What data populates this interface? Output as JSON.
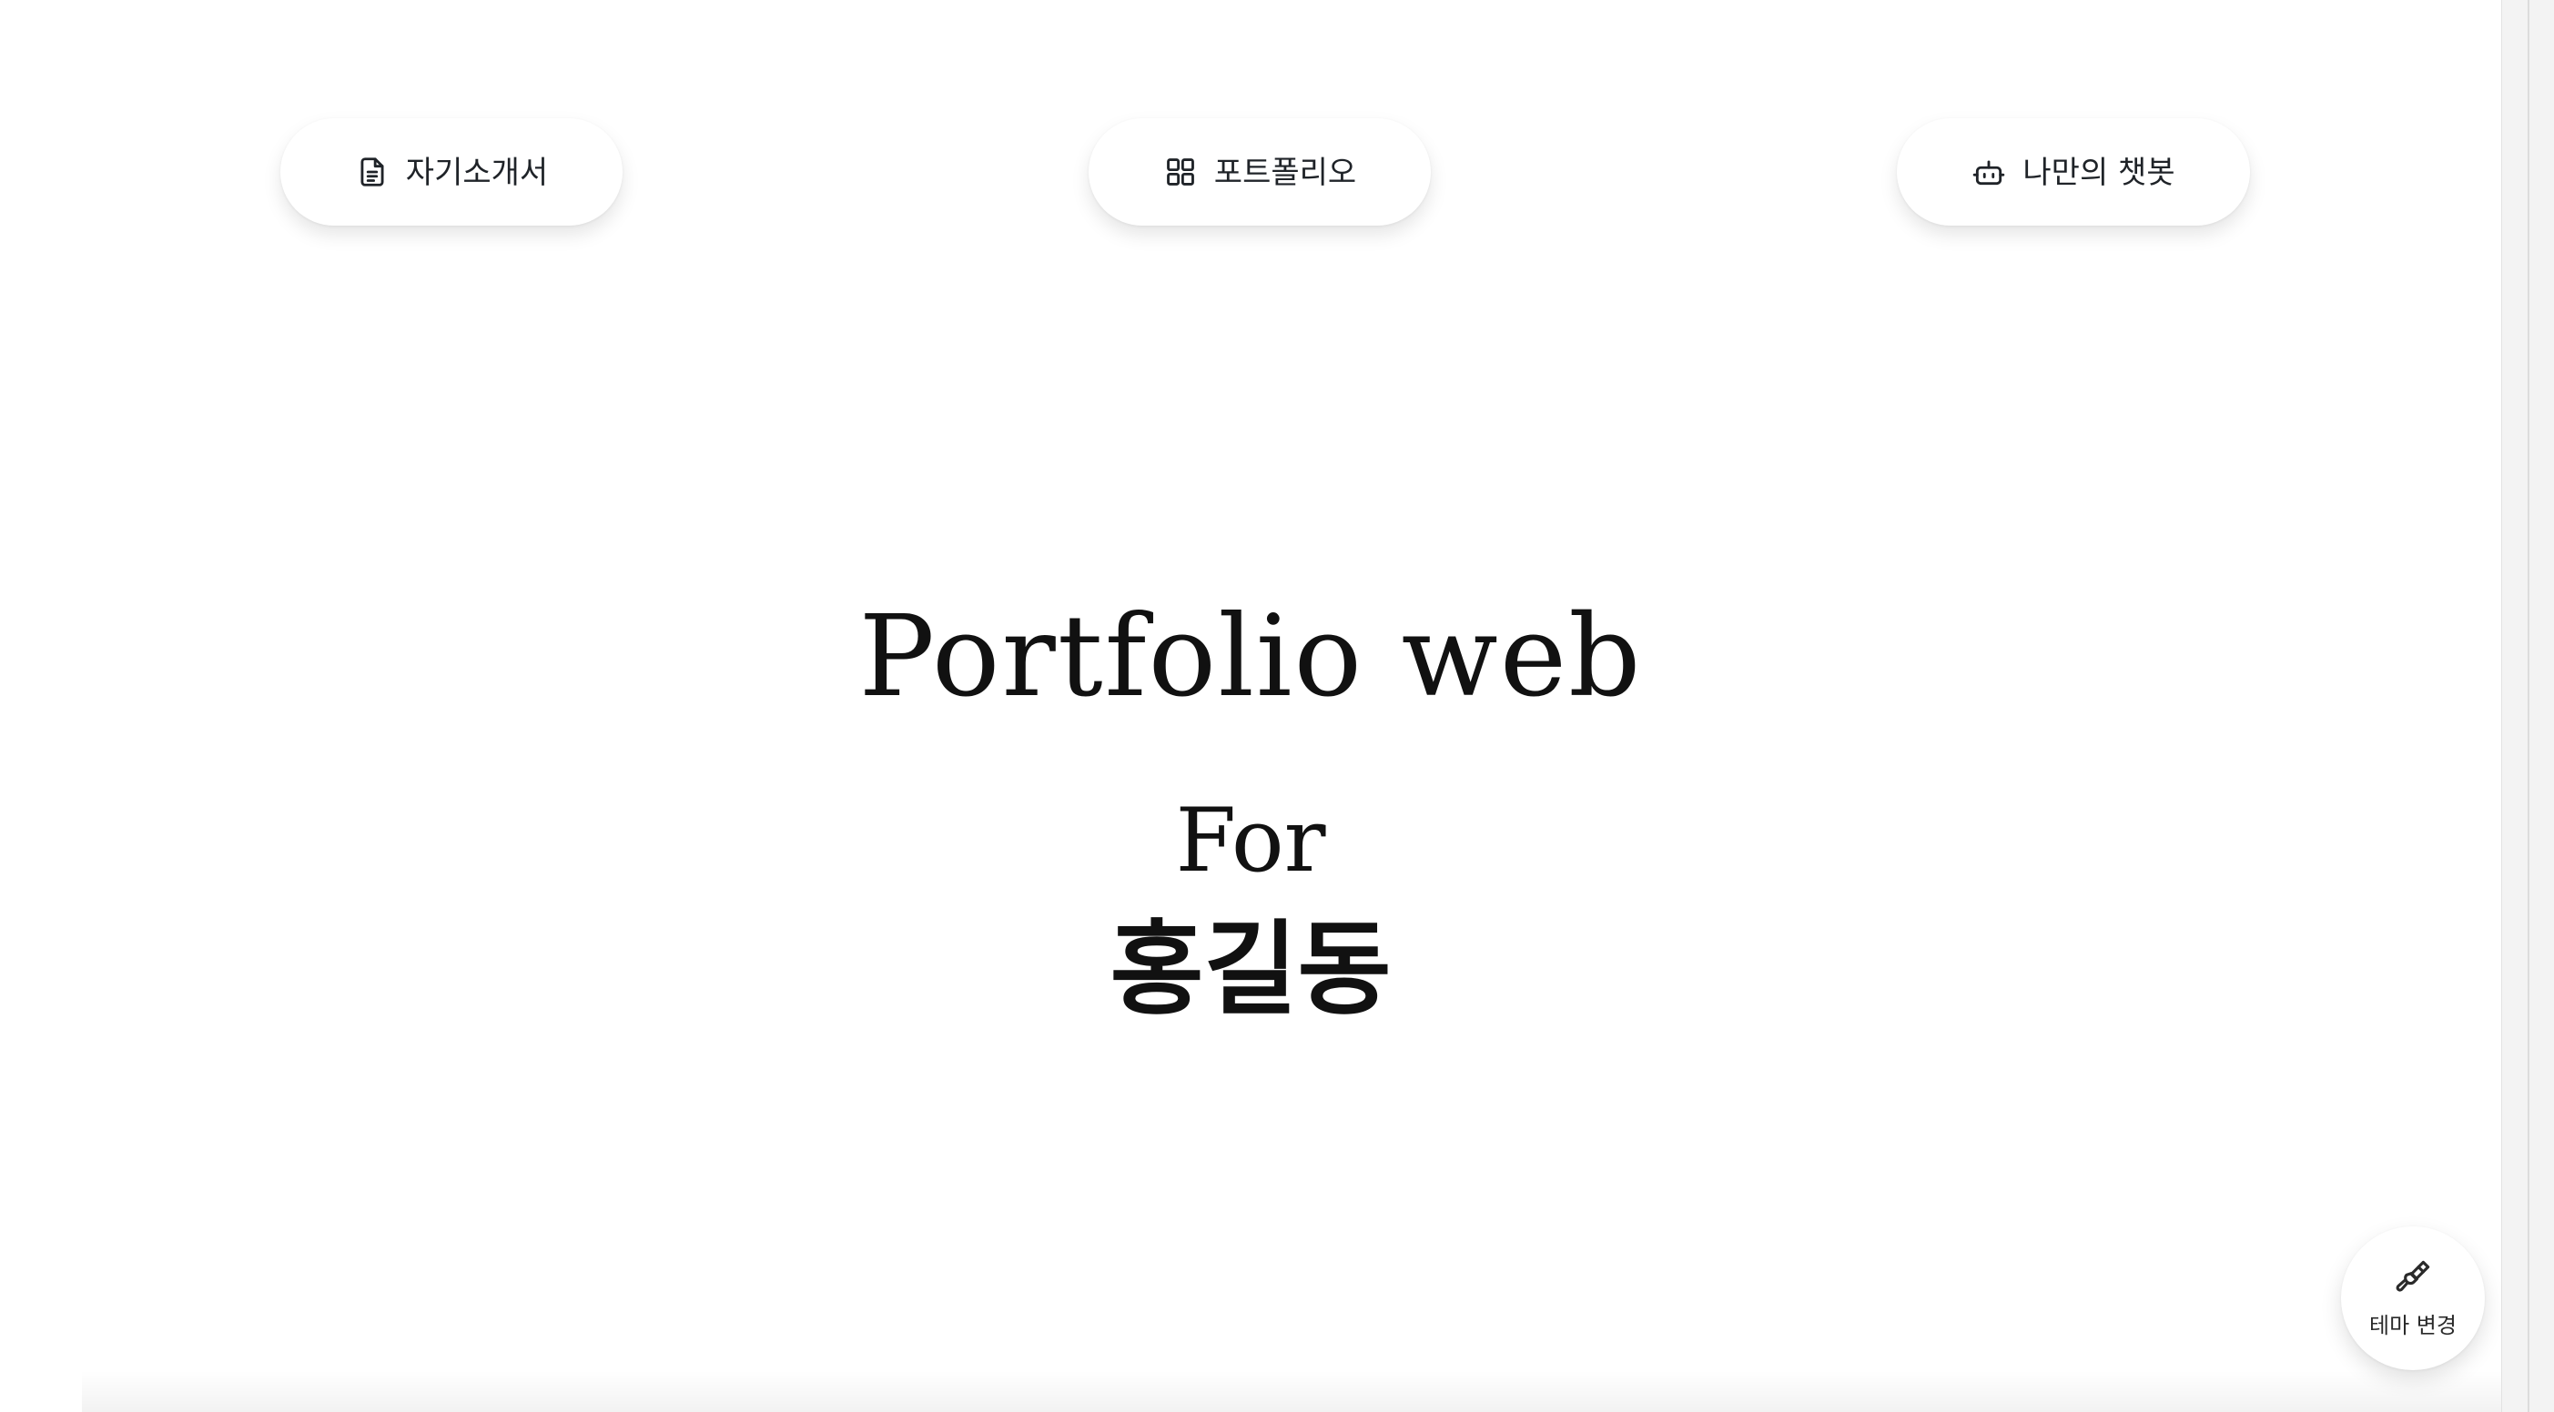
{
  "nav": {
    "intro": {
      "label": "자기소개서",
      "icon": "document-icon"
    },
    "portfolio": {
      "label": "포트폴리오",
      "icon": "grid-icon"
    },
    "chatbot": {
      "label": "나만의 챗봇",
      "icon": "robot-icon"
    }
  },
  "hero": {
    "title": "Portfolio web",
    "for": "For",
    "name": "홍길동"
  },
  "theme_button": {
    "label": "테마 변경",
    "icon": "paintbrush-icon"
  },
  "colors": {
    "background": "#ffffff",
    "text": "#111111",
    "icon": "#1f2328"
  }
}
